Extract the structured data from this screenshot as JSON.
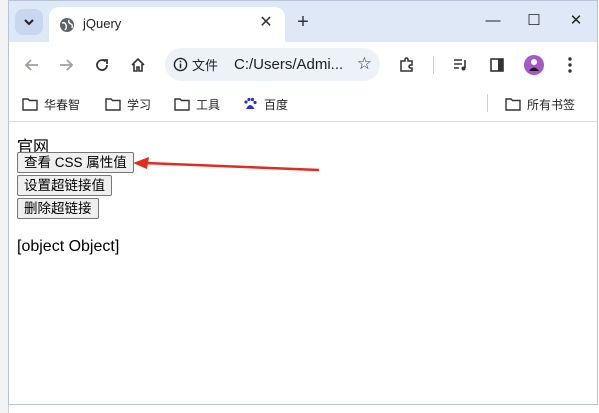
{
  "browser": {
    "tab_title": "jQuery",
    "new_tab_symbol": "+",
    "tab_close_symbol": "✕",
    "window_controls": {
      "minimize": "—",
      "maximize": "☐",
      "close": "✕"
    },
    "omnibox": {
      "site_chip_label": "文件",
      "url": "C:/Users/Admi..."
    },
    "bookmarks": [
      "华春智",
      "学习",
      "工具",
      "百度"
    ],
    "all_bookmarks_label": "所有书签",
    "avatar_color": "#a558c9"
  },
  "page": {
    "heading_text": "官网",
    "buttons": [
      "查看 CSS 属性值",
      "设置超链接值",
      "删除超链接"
    ],
    "output_text": "[object Object]"
  },
  "annotation": {
    "arrow_color": "#e52a21"
  }
}
